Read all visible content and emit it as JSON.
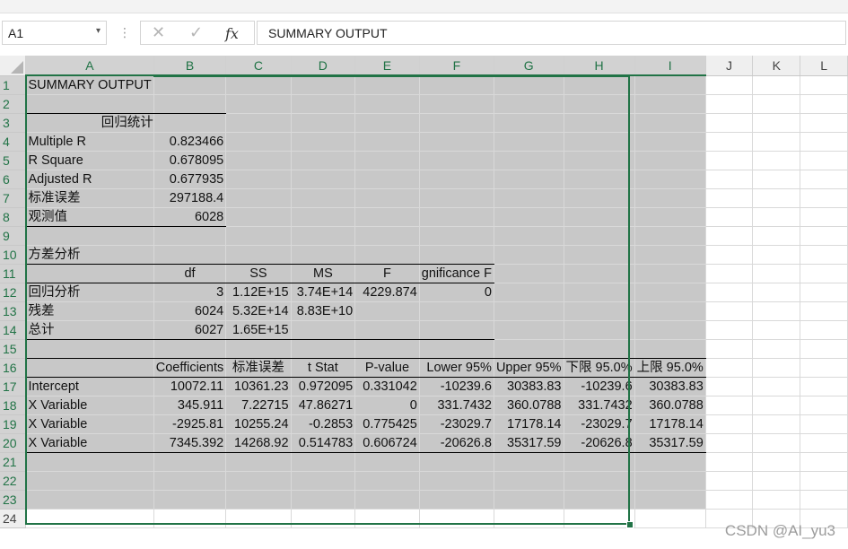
{
  "formula_bar": {
    "cell_ref": "A1",
    "namebox_arrow": "▾",
    "separator": "⋮",
    "cancel_glyph": "✕",
    "enter_glyph": "✓",
    "fx_label": "fx",
    "content": "SUMMARY OUTPUT"
  },
  "columns": [
    "A",
    "B",
    "C",
    "D",
    "E",
    "F",
    "G",
    "H",
    "I",
    "J",
    "K",
    "L"
  ],
  "rows": [
    {
      "n": "1",
      "cells": [
        "SUMMARY OUTPUT",
        "",
        "",
        "",
        "",
        "",
        "",
        "",
        ""
      ]
    },
    {
      "n": "2",
      "cells": [
        "",
        "",
        "",
        "",
        "",
        "",
        "",
        "",
        ""
      ]
    },
    {
      "n": "3",
      "cells": [
        "回归统计",
        "",
        "",
        "",
        "",
        "",
        "",
        "",
        ""
      ]
    },
    {
      "n": "4",
      "cells": [
        "Multiple R",
        "0.823466",
        "",
        "",
        "",
        "",
        "",
        "",
        ""
      ]
    },
    {
      "n": "5",
      "cells": [
        "R Square",
        "0.678095",
        "",
        "",
        "",
        "",
        "",
        "",
        ""
      ]
    },
    {
      "n": "6",
      "cells": [
        "Adjusted R",
        "0.677935",
        "",
        "",
        "",
        "",
        "",
        "",
        ""
      ]
    },
    {
      "n": "7",
      "cells": [
        "标准误差",
        "297188.4",
        "",
        "",
        "",
        "",
        "",
        "",
        ""
      ]
    },
    {
      "n": "8",
      "cells": [
        "观测值",
        "6028",
        "",
        "",
        "",
        "",
        "",
        "",
        ""
      ]
    },
    {
      "n": "9",
      "cells": [
        "",
        "",
        "",
        "",
        "",
        "",
        "",
        "",
        ""
      ]
    },
    {
      "n": "10",
      "cells": [
        "方差分析",
        "",
        "",
        "",
        "",
        "",
        "",
        "",
        ""
      ]
    },
    {
      "n": "11",
      "cells": [
        "",
        "df",
        "SS",
        "MS",
        "F",
        "gnificance F",
        "",
        "",
        ""
      ]
    },
    {
      "n": "12",
      "cells": [
        "回归分析",
        "3",
        "1.12E+15",
        "3.74E+14",
        "4229.874",
        "0",
        "",
        "",
        ""
      ]
    },
    {
      "n": "13",
      "cells": [
        "残差",
        "6024",
        "5.32E+14",
        "8.83E+10",
        "",
        "",
        "",
        "",
        ""
      ]
    },
    {
      "n": "14",
      "cells": [
        "总计",
        "6027",
        "1.65E+15",
        "",
        "",
        "",
        "",
        "",
        ""
      ]
    },
    {
      "n": "15",
      "cells": [
        "",
        "",
        "",
        "",
        "",
        "",
        "",
        "",
        ""
      ]
    },
    {
      "n": "16",
      "cells": [
        "",
        "Coefficients",
        "标准误差",
        "t Stat",
        "P-value",
        "Lower 95%",
        "Upper 95%",
        "下限 95.0%",
        "上限 95.0%"
      ]
    },
    {
      "n": "17",
      "cells": [
        "Intercept",
        "10072.11",
        "10361.23",
        "0.972095",
        "0.331042",
        "-10239.6",
        "30383.83",
        "-10239.6",
        "30383.83"
      ]
    },
    {
      "n": "18",
      "cells": [
        "X Variable",
        "345.911",
        "7.22715",
        "47.86271",
        "0",
        "331.7432",
        "360.0788",
        "331.7432",
        "360.0788"
      ]
    },
    {
      "n": "19",
      "cells": [
        "X Variable",
        "-2925.81",
        "10255.24",
        "-0.2853",
        "0.775425",
        "-23029.7",
        "17178.14",
        "-23029.7",
        "17178.14"
      ]
    },
    {
      "n": "20",
      "cells": [
        "X Variable",
        "7345.392",
        "14268.92",
        "0.514783",
        "0.606724",
        "-20626.8",
        "35317.59",
        "-20626.8",
        "35317.59"
      ]
    },
    {
      "n": "21",
      "cells": [
        "",
        "",
        "",
        "",
        "",
        "",
        "",
        "",
        ""
      ]
    },
    {
      "n": "22",
      "cells": [
        "",
        "",
        "",
        "",
        "",
        "",
        "",
        "",
        ""
      ]
    },
    {
      "n": "23",
      "cells": [
        "",
        "",
        "",
        "",
        "",
        "",
        "",
        "",
        ""
      ]
    },
    {
      "n": "24",
      "cells": [
        "",
        "",
        "",
        "",
        "",
        "",
        "",
        "",
        ""
      ]
    }
  ],
  "watermark": "CSDN @AI_yu3",
  "colors": {
    "selection_green": "#217346",
    "selected_fill": "#c8c8c8"
  }
}
